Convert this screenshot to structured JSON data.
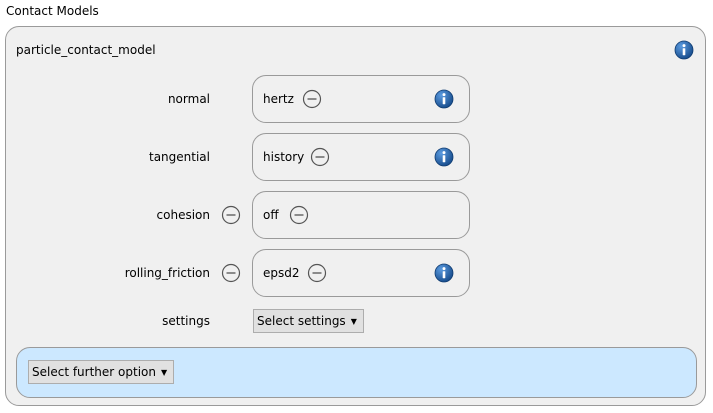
{
  "section": {
    "title": "Contact Models"
  },
  "model": {
    "title": "particle_contact_model",
    "info_icon": "info-icon"
  },
  "rows": [
    {
      "label": "normal",
      "value": "hertz",
      "label_removable": false,
      "value_removable": true,
      "has_info": true
    },
    {
      "label": "tangential",
      "value": "history",
      "label_removable": false,
      "value_removable": true,
      "has_info": true
    },
    {
      "label": "cohesion",
      "value": "off",
      "label_removable": true,
      "value_removable": true,
      "has_info": false
    },
    {
      "label": "rolling_friction",
      "value": "epsd2",
      "label_removable": true,
      "value_removable": true,
      "has_info": true
    }
  ],
  "settings": {
    "label": "settings",
    "dropdown_label": "Select settings"
  },
  "further": {
    "dropdown_label": "Select further option"
  },
  "icons": {
    "info": "info-icon",
    "remove": "minus-circle-icon",
    "caret": "caret-down-icon"
  },
  "colors": {
    "info_blue": "#1f5fa6",
    "further_bg": "#cce8ff",
    "panel_bg": "#f0f0f0"
  }
}
